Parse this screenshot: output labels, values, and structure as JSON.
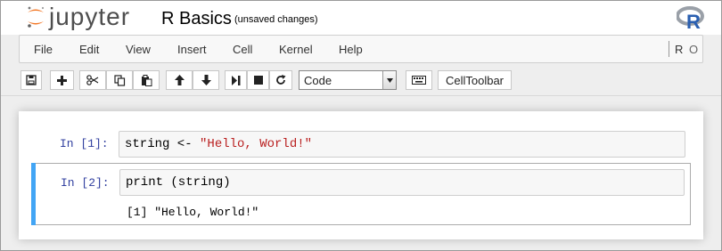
{
  "header": {
    "logo_text": "jupyter",
    "notebook_title": "R Basics",
    "save_status": "(unsaved changes)",
    "kernel_logo_letter": "R"
  },
  "menubar": {
    "items": [
      "File",
      "Edit",
      "View",
      "Insert",
      "Cell",
      "Kernel",
      "Help"
    ],
    "kernel_name": "R",
    "kernel_status_icon": "circle-idle-icon"
  },
  "toolbar": {
    "icons": [
      "save-icon",
      "plus-icon",
      "cut-icon",
      "copy-icon",
      "paste-icon",
      "arrow-up-icon",
      "arrow-down-icon",
      "step-forward-icon",
      "stop-icon",
      "refresh-icon",
      "keyboard-icon"
    ],
    "cell_type_value": "Code",
    "celltoolbar_label": "CellToolbar"
  },
  "cells": [
    {
      "prompt": "In [1]:",
      "code_prefix": "string <- ",
      "code_string": "\"Hello, World!\"",
      "output": ""
    },
    {
      "prompt": "In [2]:",
      "code_prefix": "print (string)",
      "code_string": "",
      "output": "[1] \"Hello, World!\""
    }
  ],
  "colors": {
    "selected_cell_bar": "#42a5f5",
    "prompt_color": "#303f9f",
    "string_color": "#ba2121",
    "jupyter_orange": "#f37726"
  }
}
